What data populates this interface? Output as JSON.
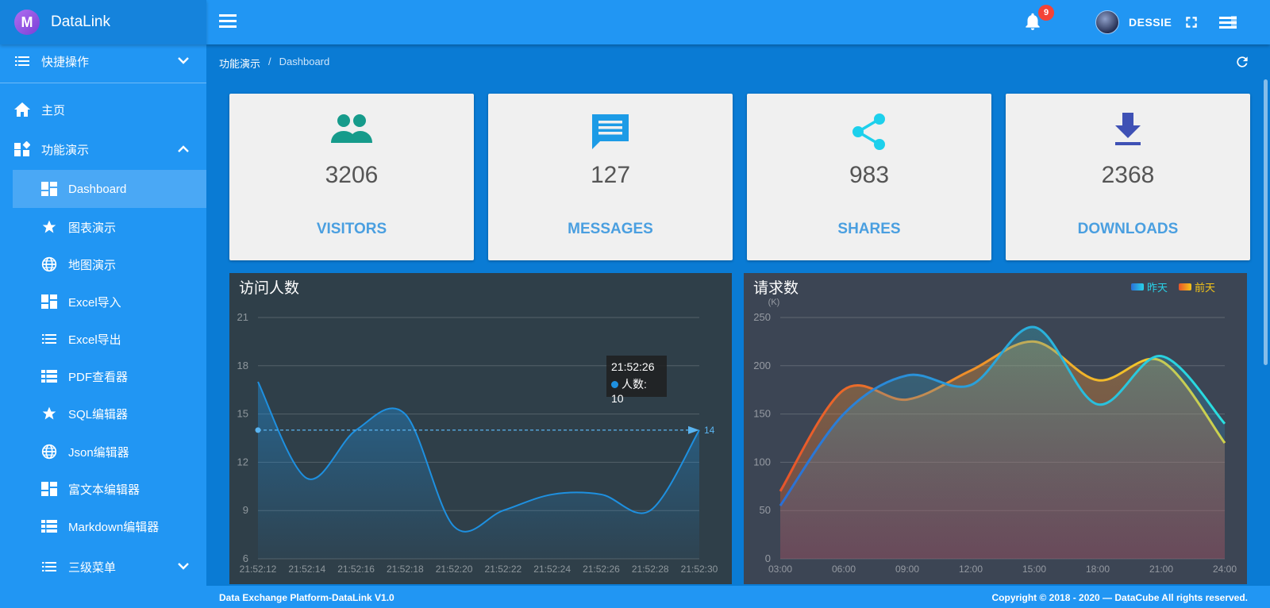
{
  "app": {
    "name": "DataLink",
    "logo_letter": "M"
  },
  "sidebar": {
    "items": [
      {
        "label": "快捷操作",
        "icon": "list-icon",
        "chevron": "expand"
      },
      {
        "label": "主页",
        "icon": "home-icon"
      },
      {
        "label": "功能演示",
        "icon": "widgets-icon",
        "chevron": "collapse"
      },
      {
        "label": "Dashboard",
        "icon": "dashboard-icon",
        "active": true
      },
      {
        "label": "图表演示",
        "icon": "star-icon"
      },
      {
        "label": "地图演示",
        "icon": "globe-icon"
      },
      {
        "label": "Excel导入",
        "icon": "dashboard-icon"
      },
      {
        "label": "Excel导出",
        "icon": "list-icon"
      },
      {
        "label": "PDF查看器",
        "icon": "table-icon"
      },
      {
        "label": "SQL编辑器",
        "icon": "star-icon"
      },
      {
        "label": "Json编辑器",
        "icon": "globe-icon"
      },
      {
        "label": "富文本编辑器",
        "icon": "dashboard-icon"
      },
      {
        "label": "Markdown编辑器",
        "icon": "table-icon"
      },
      {
        "label": "三级菜单",
        "icon": "list-icon",
        "chevron": "expand"
      }
    ]
  },
  "topbar": {
    "notification_count": "9",
    "username": "DESSIE"
  },
  "breadcrumb": {
    "parent": "功能演示",
    "separator": "/",
    "current": "Dashboard"
  },
  "stats": [
    {
      "value": "3206",
      "label": "VISITORS",
      "icon": "people-icon",
      "color": "#169b8b"
    },
    {
      "value": "127",
      "label": "MESSAGES",
      "icon": "message-icon",
      "color": "#1c9be6"
    },
    {
      "value": "983",
      "label": "SHARES",
      "icon": "share-icon",
      "color": "#1dd0ec"
    },
    {
      "value": "2368",
      "label": "DOWNLOADS",
      "icon": "download-icon",
      "color": "#3f51b5"
    }
  ],
  "chart_data": [
    {
      "type": "area",
      "title": "访问人数",
      "x": [
        "21:52:12",
        "21:52:14",
        "21:52:16",
        "21:52:18",
        "21:52:20",
        "21:52:22",
        "21:52:24",
        "21:52:26",
        "21:52:28",
        "21:52:30"
      ],
      "series": [
        {
          "name": "人数",
          "values": [
            17,
            11,
            14,
            15,
            8,
            9,
            10,
            10,
            9,
            14
          ]
        }
      ],
      "ylim": [
        6,
        21
      ],
      "yticks": [
        6,
        9,
        12,
        15,
        18,
        21
      ],
      "markline": {
        "value": 14,
        "label": "14"
      },
      "tooltip": {
        "time": "21:52:26",
        "label": "人数: 10"
      },
      "grid": true,
      "color": "#1e90e0"
    },
    {
      "type": "area",
      "title": "请求数",
      "ylabel": "(K)",
      "x": [
        "03:00",
        "06:00",
        "09:00",
        "12:00",
        "15:00",
        "18:00",
        "21:00",
        "24:00"
      ],
      "series": [
        {
          "name": "昨天",
          "values": [
            55,
            150,
            190,
            180,
            240,
            160,
            210,
            140
          ],
          "color": "#29d2e8"
        },
        {
          "name": "前天",
          "values": [
            70,
            175,
            165,
            195,
            225,
            185,
            205,
            120
          ],
          "color": "#f5c518"
        }
      ],
      "ylim": [
        0,
        250
      ],
      "yticks": [
        0,
        50,
        100,
        150,
        200,
        250
      ],
      "legend": "top-right",
      "grid": true
    }
  ],
  "footer": {
    "left": "Data Exchange Platform-DataLink V1.0",
    "right": "Copyright © 2018 - 2020 — DataCube All rights reserved."
  }
}
